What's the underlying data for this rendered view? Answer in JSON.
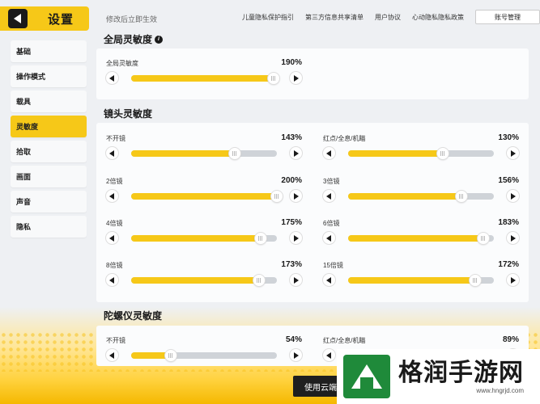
{
  "header": {
    "title": "设置",
    "hint": "修改后立即生效",
    "links": [
      "儿童隐私保护指引",
      "第三方信息共享清单",
      "用户协议",
      "心动隐私隐私政策"
    ],
    "account_button": "账号管理"
  },
  "sidebar": {
    "items": [
      {
        "label": "基础",
        "active": false
      },
      {
        "label": "操作模式",
        "active": false
      },
      {
        "label": "载具",
        "active": false
      },
      {
        "label": "灵敏度",
        "active": true
      },
      {
        "label": "拾取",
        "active": false
      },
      {
        "label": "画面",
        "active": false
      },
      {
        "label": "声音",
        "active": false
      },
      {
        "label": "隐私",
        "active": false
      }
    ]
  },
  "sections": {
    "global": {
      "title": "全局灵敏度",
      "sliders": [
        {
          "label": "全局灵敏度",
          "value": "190%",
          "fraction": 0.98
        }
      ]
    },
    "scope": {
      "title": "镜头灵敏度",
      "sliders": [
        {
          "label": "不开镜",
          "value": "143%",
          "fraction": 0.71
        },
        {
          "label": "红点/全息/机瞄",
          "value": "130%",
          "fraction": 0.65
        },
        {
          "label": "2倍镜",
          "value": "200%",
          "fraction": 1.0
        },
        {
          "label": "3倍镜",
          "value": "156%",
          "fraction": 0.78
        },
        {
          "label": "4倍镜",
          "value": "175%",
          "fraction": 0.89
        },
        {
          "label": "6倍镜",
          "value": "183%",
          "fraction": 0.93
        },
        {
          "label": "8倍镜",
          "value": "173%",
          "fraction": 0.88
        },
        {
          "label": "15倍镜",
          "value": "172%",
          "fraction": 0.87
        }
      ]
    },
    "gyro": {
      "title": "陀螺仪灵敏度",
      "sliders": [
        {
          "label": "不开镜",
          "value": "54%",
          "fraction": 0.27
        },
        {
          "label": "红点/全息/机瞄",
          "value": "89%",
          "fraction": 0.44
        }
      ]
    }
  },
  "footer": {
    "cloud_button": "使用云端"
  },
  "watermark": {
    "name": "格润手游网",
    "url": "www.hngrjd.com"
  },
  "colors": {
    "accent": "#f6c818",
    "track": "#cfd3d8",
    "dark": "#1a1a1a"
  }
}
